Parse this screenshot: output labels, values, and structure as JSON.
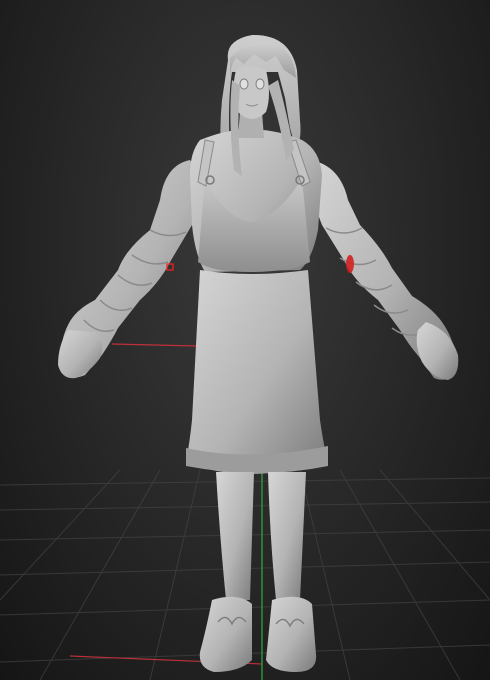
{
  "scene": {
    "background_top": "#3a3a3a",
    "background_bottom": "#151515",
    "grid_color": "#4a4a4a",
    "axis_x_color": "#c0303a",
    "axis_y_color": "#2f9a3a",
    "axis_z_color": "#4a55c8",
    "model_color": "#b8b8b8",
    "mask_marker_color": "#ff2020"
  },
  "model": {
    "icon_name": "sculpt-model-girl-in-dress"
  }
}
